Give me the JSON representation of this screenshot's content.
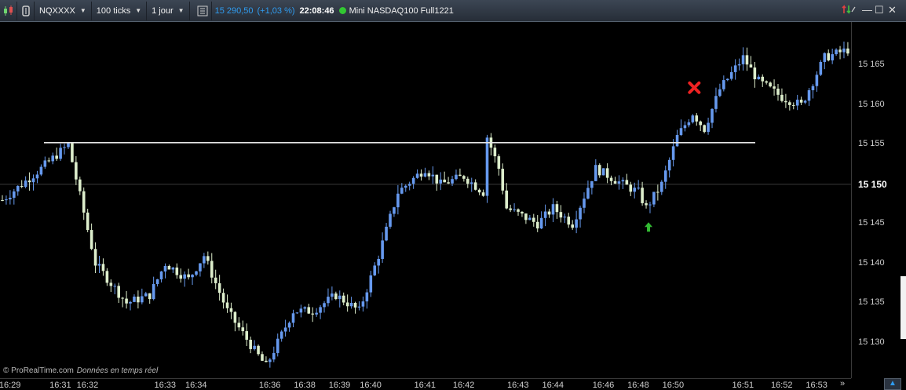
{
  "toolbar": {
    "instrument": "NQXXXX",
    "ticks": "100 ticks",
    "period": "1 jour",
    "price": "15 290,50",
    "change": "(+1,03 %)",
    "time": "22:08:46",
    "name": "Mini NASDAQ100 Full1221"
  },
  "price_axis": {
    "labels": [
      "15 165",
      "15 160",
      "15 155",
      "15 150",
      "15 145",
      "15 140",
      "15 135",
      "15 130"
    ],
    "current": "15 150"
  },
  "time_axis": {
    "labels": [
      "16:29",
      "16:31",
      "16:32",
      "16:33",
      "16:34",
      "16:36",
      "16:38",
      "16:39",
      "16:40",
      "16:41",
      "16:42",
      "16:43",
      "16:44",
      "16:46",
      "16:48",
      "16:50",
      "16:51",
      "16:52",
      "16:53"
    ]
  },
  "watermark": {
    "brand": "© ProRealTime.com",
    "realtime": "Données en temps réel"
  },
  "colors": {
    "up": "#6699ee",
    "down": "#ddeecc",
    "accent": "#2f9cf0",
    "hline": "#e6e6e6",
    "sell_marker": "#ee2222",
    "buy_marker": "#33bb33"
  },
  "icons": {
    "chart_type": "candlestick-icon",
    "tools": "settings-icon",
    "info": "info-icon",
    "sync": "sync-arrows-icon",
    "min": "minimize-icon",
    "max": "maximize-icon",
    "close": "close-icon"
  },
  "chart_data": {
    "type": "candlestick",
    "ylim": [
      15125.5,
      15170.5
    ],
    "current_price": 15150,
    "horizontal_line": 15155.25,
    "x_ticks": [
      "16:29",
      "16:31",
      "16:32",
      "16:33",
      "16:34",
      "16:36",
      "16:38",
      "16:39",
      "16:40",
      "16:41",
      "16:42",
      "16:43",
      "16:44",
      "16:46",
      "16:48",
      "16:50",
      "16:51",
      "16:52",
      "16:53"
    ],
    "anchors": [
      [
        0,
        15148
      ],
      [
        10,
        15152
      ],
      [
        17,
        15155
      ],
      [
        24,
        15140
      ],
      [
        32,
        15135
      ],
      [
        38,
        15136
      ],
      [
        42,
        15140
      ],
      [
        48,
        15138
      ],
      [
        52,
        15141
      ],
      [
        58,
        15134
      ],
      [
        65,
        15129
      ],
      [
        68,
        15127
      ],
      [
        75,
        15134
      ],
      [
        80,
        15134
      ],
      [
        86,
        15136
      ],
      [
        92,
        15134
      ],
      [
        97,
        15141
      ],
      [
        102,
        15149
      ],
      [
        109,
        15152
      ],
      [
        113,
        15150
      ],
      [
        119,
        15151
      ],
      [
        124,
        15149
      ],
      [
        125,
        15156
      ],
      [
        128,
        15152
      ],
      [
        130,
        15147
      ],
      [
        138,
        15145
      ],
      [
        142,
        15147
      ],
      [
        147,
        15145
      ],
      [
        153,
        15152
      ],
      [
        160,
        15150
      ],
      [
        164,
        15149
      ],
      [
        166,
        15147
      ],
      [
        170,
        15150
      ],
      [
        174,
        15156
      ],
      [
        178,
        15159
      ],
      [
        181,
        15157
      ],
      [
        185,
        15162
      ],
      [
        191,
        15166
      ],
      [
        195,
        15163
      ],
      [
        201,
        15161
      ],
      [
        206,
        15160
      ],
      [
        212,
        15166
      ],
      [
        218,
        15167
      ]
    ],
    "candle_count": 219,
    "sell_signal_index": 178,
    "buy_signal_index": 166
  }
}
